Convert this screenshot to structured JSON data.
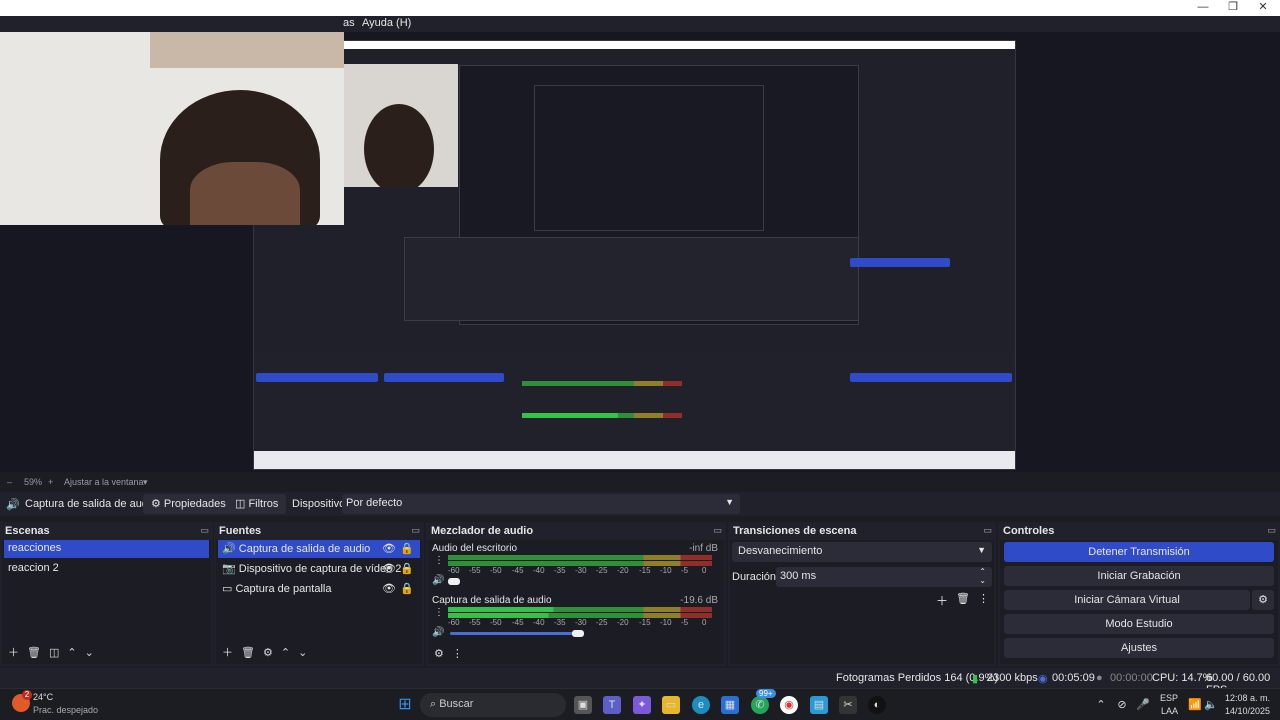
{
  "titlebar": {
    "minimize": "—",
    "restore": "❐",
    "close": "✕"
  },
  "menu": {
    "visible_partial": "as",
    "help": "Ayuda (H)"
  },
  "zoom": {
    "minus": "–",
    "percent": "59%",
    "plus": "+",
    "fit": "Ajustar a la ventana"
  },
  "source_bar": {
    "speaker_icon": "🔊",
    "source_name": "Captura de salida de audio",
    "properties": "Propiedades",
    "filters": "Filtros",
    "device_label": "Dispositivo",
    "device_value": "Por defecto"
  },
  "scenes": {
    "title": "Escenas",
    "items": [
      "reacciones",
      "reaccion 2"
    ]
  },
  "sources": {
    "title": "Fuentes",
    "items": [
      {
        "label": "Captura de salida de audio",
        "icon": "🔊"
      },
      {
        "label": "Dispositivo de captura de vídeo 2",
        "icon": "📷"
      },
      {
        "label": "Captura de pantalla",
        "icon": "▭"
      }
    ]
  },
  "mixer": {
    "title": "Mezclador de audio",
    "tracks": [
      {
        "name": "Audio del escritorio",
        "db": "-inf dB",
        "level": 0.0
      },
      {
        "name": "Captura de salida de audio",
        "db": "-19.6 dB",
        "level": 0.58
      }
    ],
    "scale": [
      "-60",
      "-55",
      "-50",
      "-45",
      "-40",
      "-35",
      "-30",
      "-25",
      "-20",
      "-15",
      "-10",
      "-5",
      "0"
    ]
  },
  "transitions": {
    "title": "Transiciones de escena",
    "selected": "Desvanecimiento",
    "duration_label": "Duración",
    "duration_value": "300 ms"
  },
  "controls": {
    "title": "Controles",
    "buttons": [
      "Detener Transmisión",
      "Iniciar Grabación",
      "Iniciar Cámara Virtual",
      "Modo Estudio",
      "Ajustes"
    ]
  },
  "status": {
    "dropped": "Fotogramas Perdidos 164 (0.9%)",
    "bitrate": "2300 kbps",
    "time1": "00:05:09",
    "time2": "00:00:00",
    "cpu": "CPU: 14.7%",
    "fps": "60.00 / 60.00 FPS"
  },
  "taskbar": {
    "weather_temp": "24°C",
    "weather_desc": "Prac. despejado",
    "weather_badge": "2",
    "search": "Buscar",
    "badge": "99+",
    "lang1": "ESP",
    "lang2": "LAA",
    "time": "12:08 a. m.",
    "date": "14/10/2025"
  },
  "colors": {
    "accent": "#2f4bc8",
    "meter_green": "#35c24a",
    "meter_yellow": "#c8b42a",
    "meter_red": "#c8352a"
  }
}
